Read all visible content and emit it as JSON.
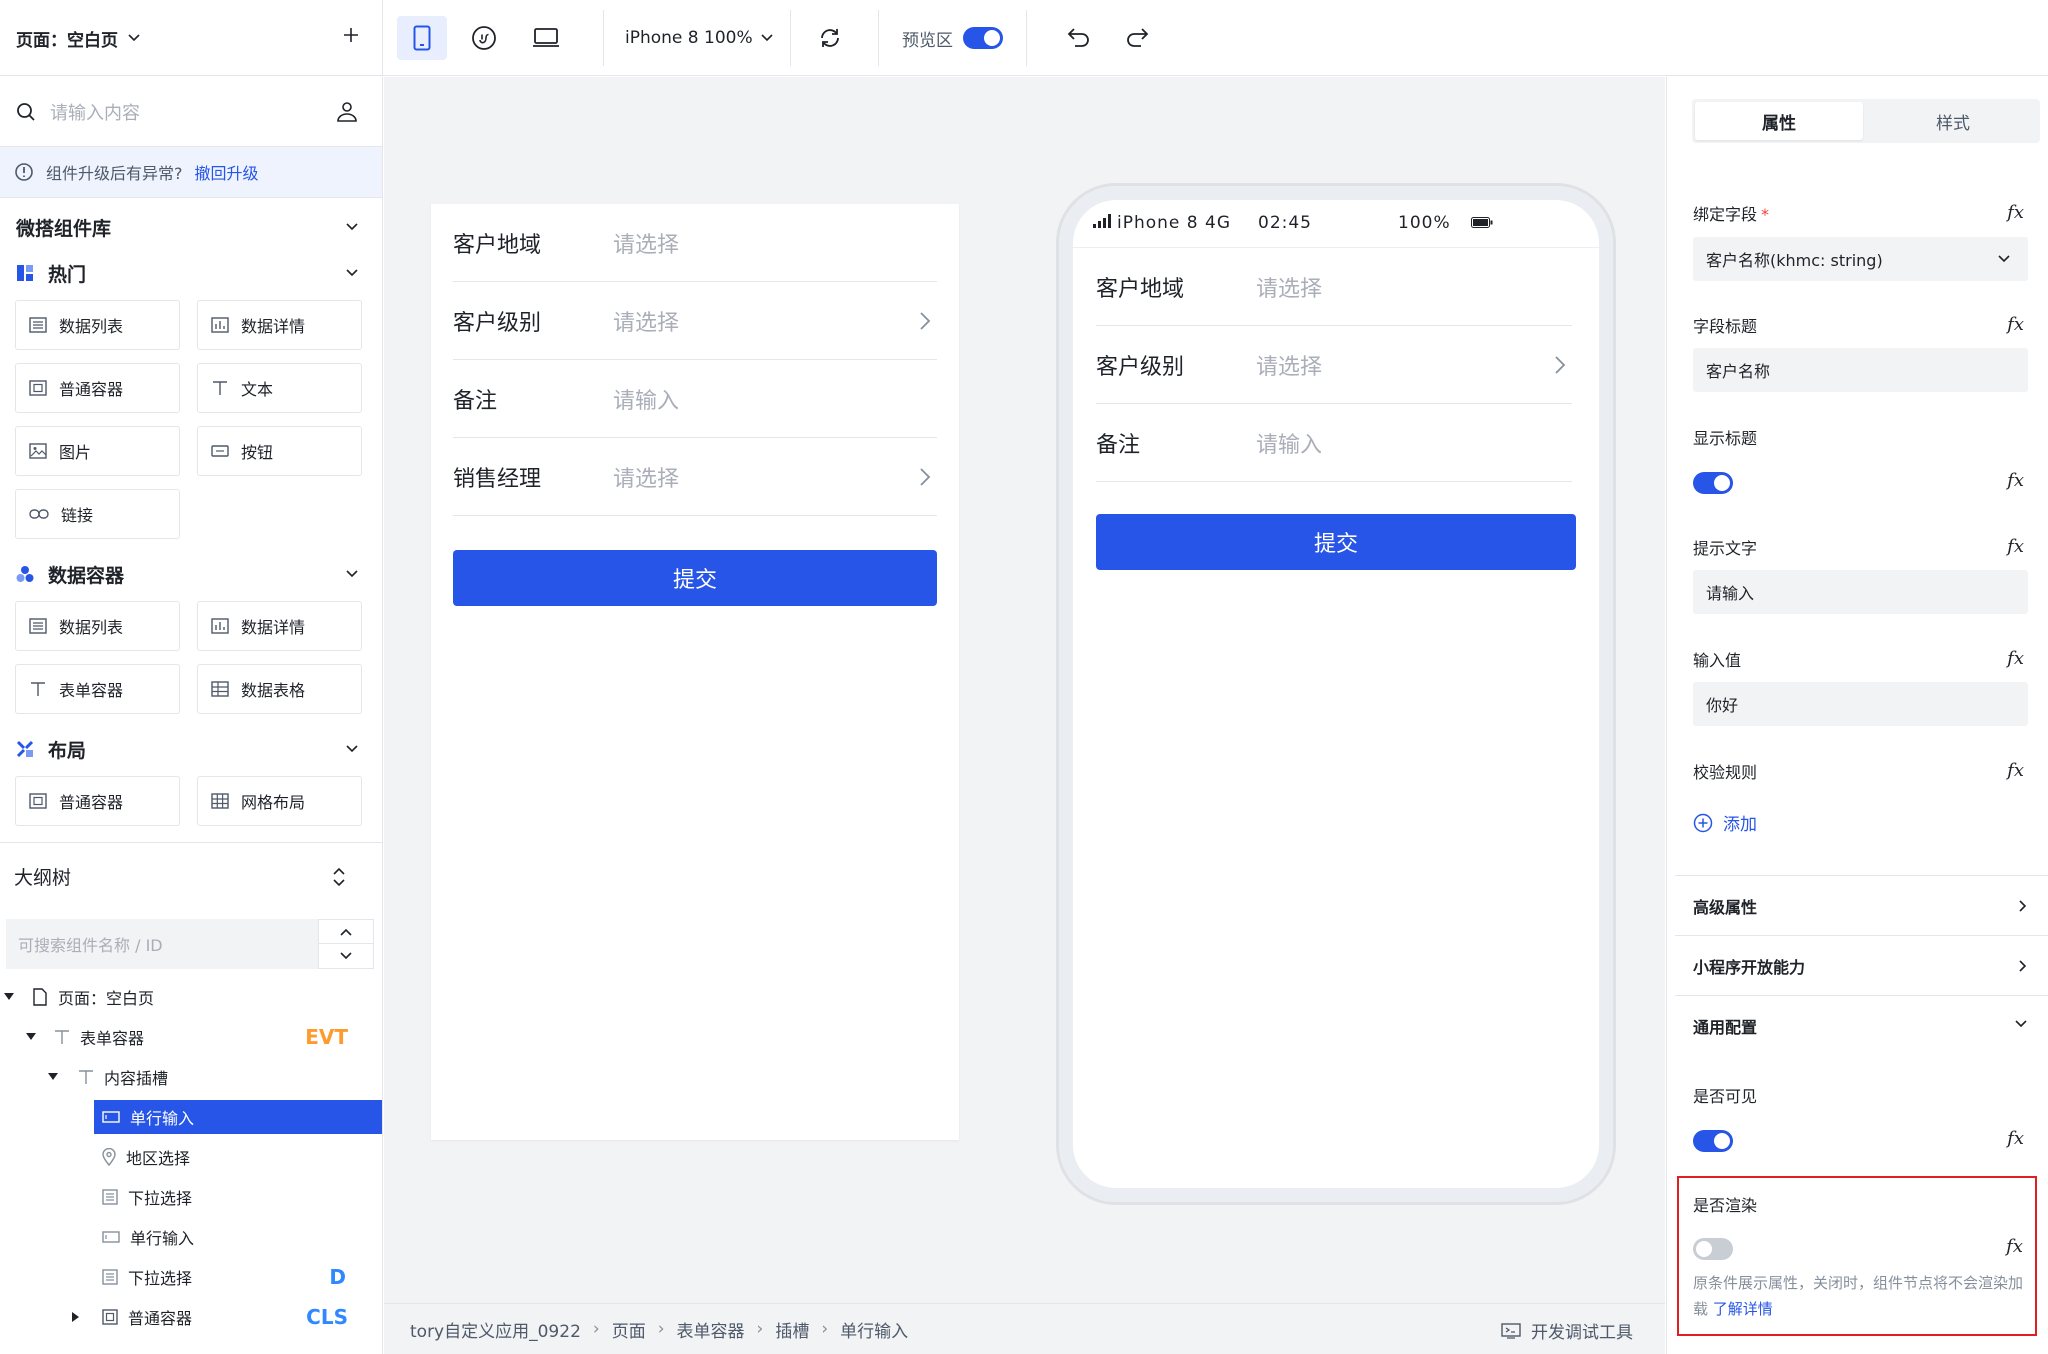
{
  "topbar": {
    "page_label": "页面：空白页",
    "device_label": "iPhone 8 100%",
    "preview_label": "预览区"
  },
  "sidebar": {
    "search_placeholder": "请输入内容",
    "upgrade_notice": "组件升级后有异常?",
    "upgrade_link": "撤回升级",
    "library_title": "微搭组件库",
    "sections": [
      {
        "title": "热门",
        "items": [
          {
            "label": "数据列表",
            "icon": "list-icon"
          },
          {
            "label": "数据详情",
            "icon": "chart-icon"
          },
          {
            "label": "普通容器",
            "icon": "container-icon"
          },
          {
            "label": "文本",
            "icon": "text-icon"
          },
          {
            "label": "图片",
            "icon": "image-icon"
          },
          {
            "label": "按钮",
            "icon": "button-icon"
          },
          {
            "label": "链接",
            "icon": "link-icon"
          }
        ]
      },
      {
        "title": "数据容器",
        "items": [
          {
            "label": "数据列表",
            "icon": "list-icon"
          },
          {
            "label": "数据详情",
            "icon": "chart-icon"
          },
          {
            "label": "表单容器",
            "icon": "text-icon"
          },
          {
            "label": "数据表格",
            "icon": "table-icon"
          }
        ]
      },
      {
        "title": "布局",
        "items": [
          {
            "label": "普通容器",
            "icon": "container-icon"
          },
          {
            "label": "网格布局",
            "icon": "grid-icon"
          }
        ]
      }
    ],
    "outline_title": "大纲树",
    "outline_search_placeholder": "可搜索组件名称 / ID",
    "tree": [
      {
        "label": "页面：空白页",
        "badge": ""
      },
      {
        "label": "表单容器",
        "badge": "EVT"
      },
      {
        "label": "内容插槽",
        "badge": ""
      },
      {
        "label": "单行输入",
        "badge": ""
      },
      {
        "label": "地区选择",
        "badge": ""
      },
      {
        "label": "下拉选择",
        "badge": ""
      },
      {
        "label": "单行输入",
        "badge": ""
      },
      {
        "label": "下拉选择",
        "badge": "D"
      },
      {
        "label": "普通容器",
        "badge": "CLS"
      }
    ],
    "badge_colors": {
      "EVT": "#ff9a2e",
      "D": "#2f88ff",
      "CLS": "#2f88ff"
    }
  },
  "canvas": {
    "form": {
      "rows": [
        {
          "label": "客户地域",
          "value": "请选择"
        },
        {
          "label": "客户级别",
          "value": "请选择"
        },
        {
          "label": "备注",
          "value": "请输入"
        },
        {
          "label": "销售经理",
          "value": "请选择"
        }
      ],
      "submit": "提交"
    },
    "phone": {
      "carrier": "iPhone 8  4G",
      "time": "02:45",
      "battery": "100%",
      "rows": [
        {
          "label": "客户地域",
          "value": "请选择"
        },
        {
          "label": "客户级别",
          "value": "请选择"
        },
        {
          "label": "备注",
          "value": "请输入"
        }
      ],
      "submit": "提交"
    },
    "breadcrumb": [
      "tory自定义应用_0922",
      "页面",
      "表单容器",
      "插槽",
      "单行输入"
    ],
    "devtools": "开发调试工具"
  },
  "panel": {
    "tabs": [
      "属性",
      "样式"
    ],
    "fields": {
      "bind_field_label": "绑定字段",
      "bind_field_value": "客户名称(khmc: string)",
      "title_label": "字段标题",
      "title_value": "客户名称",
      "show_title_label": "显示标题",
      "placeholder_label": "提示文字",
      "placeholder_value": "请输入",
      "input_value_label": "输入值",
      "input_value": "你好",
      "rules_label": "校验规则",
      "add_label": "添加"
    },
    "sections": [
      "高级属性",
      "小程序开放能力",
      "通用配置"
    ],
    "visible_label": "是否可见",
    "render_label": "是否渲染",
    "render_desc": "原条件展示属性，关闭时，组件节点将不会渲染加载",
    "render_link": "了解详情",
    "fx": "fx"
  },
  "colors": {
    "accent": "#2755e8",
    "highlight_border": "#e02020"
  }
}
